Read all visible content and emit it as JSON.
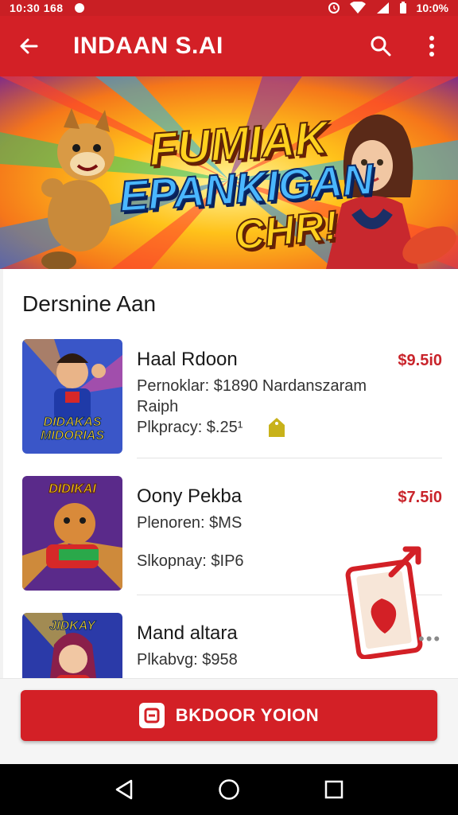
{
  "status_bar": {
    "time": "10:30 168",
    "battery": "10:0%"
  },
  "app_bar": {
    "title": "INDAAN S.AI",
    "icons": [
      "back-arrow-icon",
      "search-icon",
      "more-vert-icon"
    ]
  },
  "banner": {
    "headline_lines": [
      "FUMIAK",
      "EPANKIGAN",
      "CHR!"
    ]
  },
  "section": {
    "title": "Dersnine Aan"
  },
  "items": [
    {
      "name": "Haal Rdoon",
      "price": "$9.5i0",
      "meta1": "Pernoklar: $1890 Nardanszaram Raiph",
      "meta2": "Plkpracy: $.25¹",
      "thumb_text": "DIDAKAS MIDORIAS",
      "badge_icon": "tag-icon"
    },
    {
      "name": "Oony Pekba",
      "price": "$7.5i0",
      "meta1": "Plenoren: $MS",
      "meta2": "Slkopnay: $IP6",
      "thumb_text": "DIDIKAI"
    },
    {
      "name": "Mand altara",
      "meta1": "Plkabvg: $958",
      "thumb_text": "JIDKAY"
    }
  ],
  "floating_card_icon": "share-card-icon",
  "more_icon": "more-horiz-icon",
  "primary_button": {
    "label": "BKDOOR YOION",
    "icon": "ticket-icon"
  },
  "nav_bar": {
    "icons": [
      "nav-back-icon",
      "nav-home-icon",
      "nav-recents-icon"
    ]
  },
  "colors": {
    "brand_red": "#d32026",
    "price_red": "#c9242b",
    "nav_black": "#000000"
  }
}
